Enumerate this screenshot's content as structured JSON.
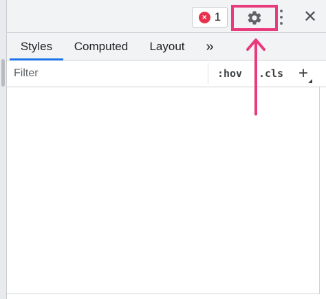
{
  "toolbar": {
    "error_badge": {
      "icon": "error-x-icon",
      "icon_glyph": "×",
      "count": "1",
      "color": "#e8324b"
    },
    "settings": {
      "icon": "gear-icon",
      "highlight_color": "#e93a7d"
    },
    "more": {
      "icon": "kebab-menu-icon"
    },
    "close": {
      "icon": "close-icon",
      "glyph": "✕"
    }
  },
  "tabs": [
    {
      "label": "Styles",
      "active": true
    },
    {
      "label": "Computed",
      "active": false
    },
    {
      "label": "Layout",
      "active": false
    },
    {
      "label": "»",
      "active": false
    }
  ],
  "filter": {
    "placeholder": "Filter",
    "hov_label": ":hov",
    "cls_label": ".cls",
    "add_glyph": "+"
  },
  "annotation": {
    "icon": "arrow-up-icon",
    "color": "#e93a7d"
  },
  "colors": {
    "accent": "#1a73e8",
    "highlight": "#e93a7d",
    "error": "#e8324b"
  }
}
